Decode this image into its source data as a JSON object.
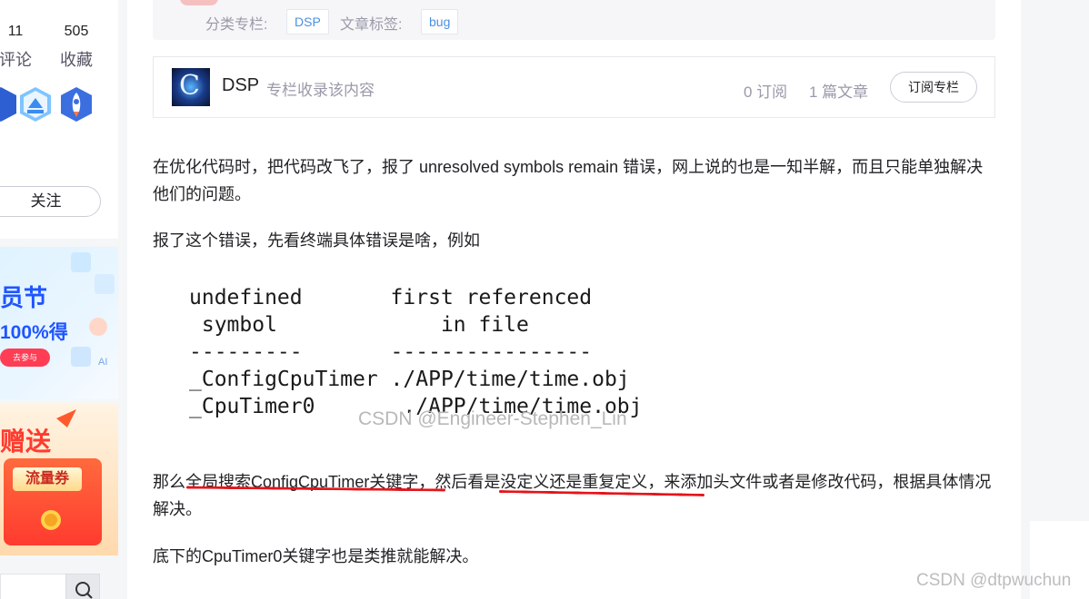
{
  "sidebar": {
    "stats": [
      {
        "num": "11",
        "label": "评论"
      },
      {
        "num": "505",
        "label": "收藏"
      }
    ],
    "badges": [
      "blue-badge-icon",
      "cloud-badge-icon",
      "rocket-badge-icon"
    ],
    "follow_label": "关注",
    "ad1": {
      "line1": "员节",
      "line2": "100%得",
      "button": "去参与"
    },
    "ad2": {
      "line1": "赠送",
      "coupon": "流量券"
    }
  },
  "category": {
    "column_label": "分类专栏:",
    "column_tag": "DSP",
    "tag_label": "文章标签:",
    "tag": "bug"
  },
  "column": {
    "logo_letter": "C",
    "name": "DSP",
    "desc": "专栏收录该内容",
    "subs": "0 订阅",
    "articles": "1 篇文章",
    "subscribe": "订阅专栏"
  },
  "article": {
    "p1": "在优化代码时，把代码改飞了，报了 unresolved symbols remain 错误，网上说的也是一知半解，而且只能单独解决他们的问题。",
    "p2": "报了这个错误，先看终端具体错误是啥，例如",
    "code": "undefined       first referenced\n symbol             in file\n---------       ----------------\n_ConfigCpuTimer ./APP/time/time.obj\n_CpuTimer0       ./APP/time/time.obj",
    "code_watermark": "CSDN @Engineer-Stephen_Lin",
    "p3": "那么全局搜索ConfigCpuTimer关键字，然后看是没定义还是重复定义，来添加头文件或者是修改代码，根据具体情况解决。",
    "p4": "底下的CpuTimer0关键字也是类推就能解决。"
  },
  "watermark": "CSDN @dtpwuchun",
  "colors": {
    "underline": "#e5141a",
    "tag_text": "#4a90e2"
  }
}
